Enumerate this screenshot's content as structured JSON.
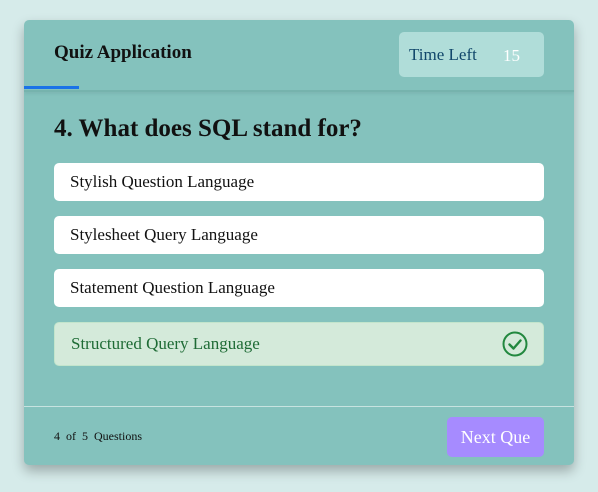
{
  "header": {
    "title": "Quiz Application",
    "timer_label": "Time Left",
    "timer_seconds": "15"
  },
  "question": {
    "text": "4. What does SQL stand for?",
    "options": [
      {
        "label": "Stylish Question Language",
        "state": "default"
      },
      {
        "label": "Stylesheet Query Language",
        "state": "default"
      },
      {
        "label": "Statement Question Language",
        "state": "default"
      },
      {
        "label": "Structured Query Language",
        "state": "correct",
        "icon": "check-circle-icon"
      }
    ]
  },
  "footer": {
    "progress_text": "4 of 5 Questions",
    "next_button_label": "Next Que"
  },
  "colors": {
    "background": "#d6ebea",
    "card": "#84c2bd",
    "accent_line": "#1a73e8",
    "correct_bg": "#d4eada",
    "correct_text": "#1e6b35",
    "next_button": "#a68bff"
  }
}
